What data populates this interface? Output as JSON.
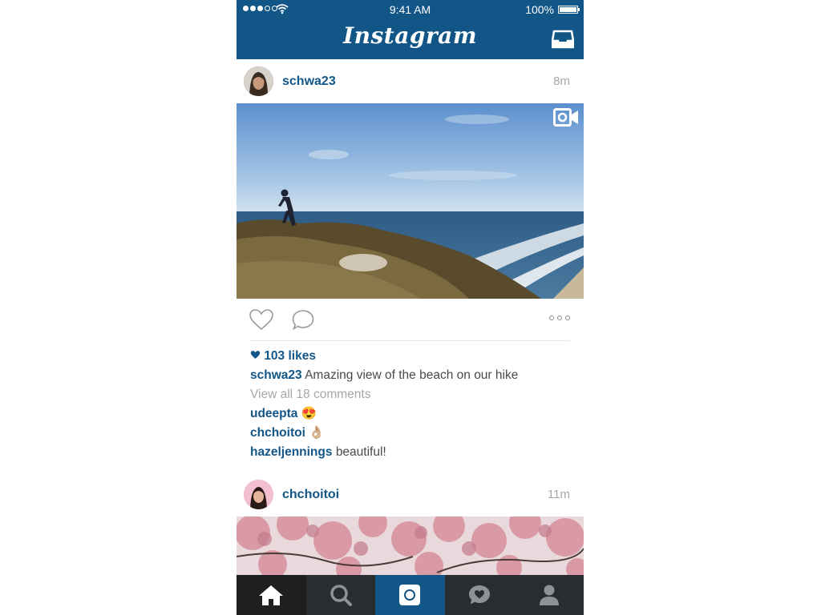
{
  "status_bar": {
    "time": "9:41 AM",
    "battery_percent": "100%",
    "signal_bars_filled": 3,
    "signal_bars_total": 5
  },
  "header": {
    "title": "Instagram",
    "brand_color": "#125688",
    "inbox_icon": "inbox-tray-icon"
  },
  "posts": [
    {
      "username": "schwa23",
      "time_ago": "8m",
      "media_type": "video",
      "likes": "103 likes",
      "caption_user": "schwa23",
      "caption_text": "Amazing view of the beach on our hike",
      "view_all_comments": "View all 18 comments",
      "comments": [
        {
          "user": "udeepta",
          "text": "😍"
        },
        {
          "user": "chchoitoi",
          "text": "👌🏼"
        },
        {
          "user": "hazeljennings",
          "text": "beautiful!"
        }
      ]
    },
    {
      "username": "chchoitoi",
      "time_ago": "11m"
    }
  ],
  "tabbar": {
    "tabs": [
      {
        "name": "home",
        "icon": "home-icon",
        "active": true
      },
      {
        "name": "search",
        "icon": "search-icon"
      },
      {
        "name": "camera",
        "icon": "camera-icon"
      },
      {
        "name": "activity",
        "icon": "activity-heart-icon"
      },
      {
        "name": "profile",
        "icon": "profile-icon"
      }
    ]
  }
}
